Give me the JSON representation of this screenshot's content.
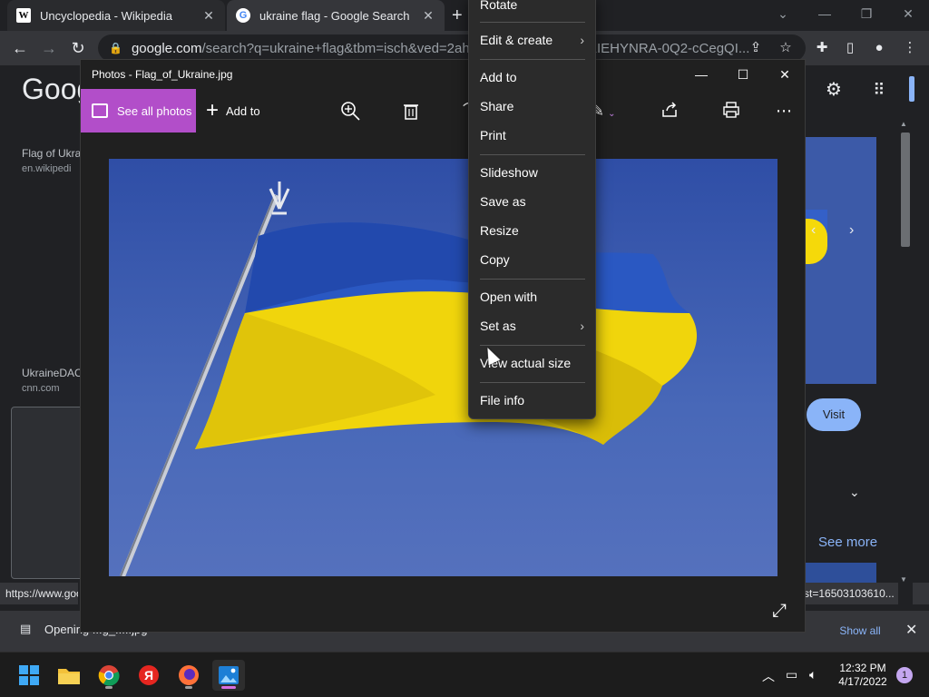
{
  "browser": {
    "tabs": [
      {
        "title": "Uncyclopedia - Wikipedia",
        "favicon": "W"
      },
      {
        "title": "ukraine flag - Google Search",
        "favicon": "G"
      }
    ],
    "new_tab": "+",
    "address": {
      "host": "google.com",
      "path": "/search?q=ukraine+flag&tbm=isch&ved=2ahUK",
      "tail": "KIEHYNRA-0Q2-cCegQI..."
    }
  },
  "page": {
    "logo": "Goog",
    "results": [
      {
        "title": "Flag of Ukra",
        "source": "en.wikipedi"
      },
      {
        "title": "UkraineDAC",
        "source": "cnn.com"
      }
    ],
    "visit_label": "Visit",
    "see_more_label": "See more",
    "status_left": "https://www.goo",
    "status_right": "st=16503103610..."
  },
  "downloads": {
    "file_label": "Opening ...g_.....jpg",
    "show_all": "Show all"
  },
  "photos": {
    "title": "Photos - Flag_of_Ukraine.jpg",
    "see_all": "See all photos",
    "add_to": "Add to"
  },
  "context_menu": {
    "items": [
      {
        "label": "Rotate"
      },
      {
        "label": "Edit & create",
        "submenu": true
      },
      {
        "label": "Add to"
      },
      {
        "label": "Share"
      },
      {
        "label": "Print"
      },
      {
        "label": "Slideshow"
      },
      {
        "label": "Save as"
      },
      {
        "label": "Resize"
      },
      {
        "label": "Copy"
      },
      {
        "label": "Open with"
      },
      {
        "label": "Set as",
        "submenu": true
      },
      {
        "label": "View actual size"
      },
      {
        "label": "File info"
      }
    ]
  },
  "taskbar": {
    "time": "12:32 PM",
    "date": "4/17/2022",
    "notifications": "1"
  },
  "colors": {
    "accent": "#b24ec9",
    "flag_blue": "#2b5bc0",
    "flag_yellow": "#f2d80c",
    "link": "#8ab4f8"
  }
}
